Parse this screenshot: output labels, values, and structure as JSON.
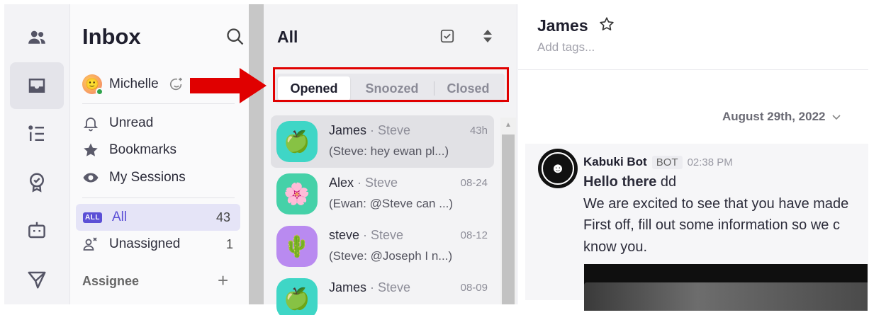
{
  "sidebar": {
    "title": "Inbox",
    "profile": {
      "name": "Michelle"
    },
    "nav_items": [
      {
        "label": "Unread"
      },
      {
        "label": "Bookmarks"
      },
      {
        "label": "My Sessions"
      }
    ],
    "inbox_items": [
      {
        "label": "All",
        "count": "43",
        "badge": "ALL"
      },
      {
        "label": "Unassigned",
        "count": "1"
      }
    ],
    "section_title": "Assignee"
  },
  "conversation_list": {
    "title": "All",
    "tabs": [
      "Opened",
      "Snoozed",
      "Closed"
    ],
    "active_tab": "Opened",
    "conversations": [
      {
        "avatar": "🍏",
        "avatar_bg": "#3fd6c6",
        "name": "James",
        "sub": "· Steve",
        "time": "43h",
        "preview": "(Steve: hey ewan pl...)"
      },
      {
        "avatar": "🌸",
        "avatar_bg": "#45d1a8",
        "name": "Alex",
        "sub": "· Steve",
        "time": "08-24",
        "preview": "(Ewan: @Steve can ...)"
      },
      {
        "avatar": "🌵",
        "avatar_bg": "#b98af0",
        "name": "steve",
        "sub": "· Steve",
        "time": "08-12",
        "preview": "(Steve: @Joseph I n...)"
      },
      {
        "avatar": "🍏",
        "avatar_bg": "#3fd6c6",
        "name": "James",
        "sub": "· Steve",
        "time": "08-09",
        "preview": ""
      }
    ]
  },
  "chat": {
    "contact_name": "James",
    "tags_placeholder": "Add tags...",
    "date_separator": "August 29th, 2022",
    "message": {
      "sender": "Kabuki Bot",
      "sender_tag": "BOT",
      "time": "02:38 PM",
      "greeting_bold": "Hello there",
      "greeting_rest": " dd",
      "lines": [
        "We are excited to see that you have made",
        "First off, fill out some information so we c",
        "know you."
      ]
    }
  },
  "colors": {
    "accent": "#5b4fd6",
    "highlight": "#e00000",
    "online": "#2fa34b"
  }
}
